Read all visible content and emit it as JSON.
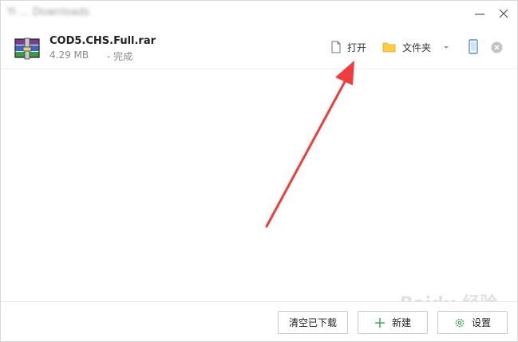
{
  "window": {
    "title": "Yi ... Downloads"
  },
  "download": {
    "file_name": "COD5.CHS.Full.rar",
    "file_size": "4.29 MB",
    "status": "- 完成",
    "open_label": "打开",
    "folder_label": "文件夹"
  },
  "footer": {
    "clear_label": "清空已下载",
    "new_label": "新建",
    "settings_label": "设置"
  },
  "watermark": {
    "text": "Baidu 经验"
  },
  "colors": {
    "arrow": "#f03c3c",
    "folder": "#ffcc44",
    "new_plus": "#3aaa55",
    "settings_gear": "#3aaa55",
    "phone": "#4a90e2"
  }
}
